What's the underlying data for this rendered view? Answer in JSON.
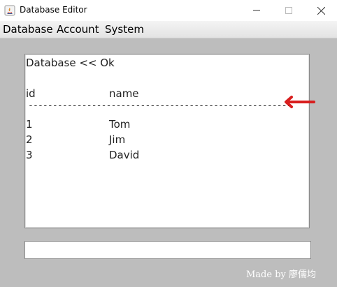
{
  "window": {
    "title": "Database Editor",
    "minimize_glyph": "—",
    "maximize_glyph": "☐",
    "close_glyph": "✕"
  },
  "menu": {
    "items": [
      "Database",
      "Account",
      "System"
    ]
  },
  "output": {
    "status": "Database << Ok",
    "headers": [
      "id",
      "name"
    ],
    "separator": "------------------------------------------------------",
    "rows": [
      {
        "id": "1",
        "name": "Tom"
      },
      {
        "id": "2",
        "name": "Jim"
      },
      {
        "id": "3",
        "name": "David"
      }
    ]
  },
  "annotation": {
    "icon": "left-arrow-icon",
    "color": "#d81e1e"
  },
  "command": {
    "value": "",
    "placeholder": ""
  },
  "footer": {
    "credit": "Made by 廖儒均"
  }
}
